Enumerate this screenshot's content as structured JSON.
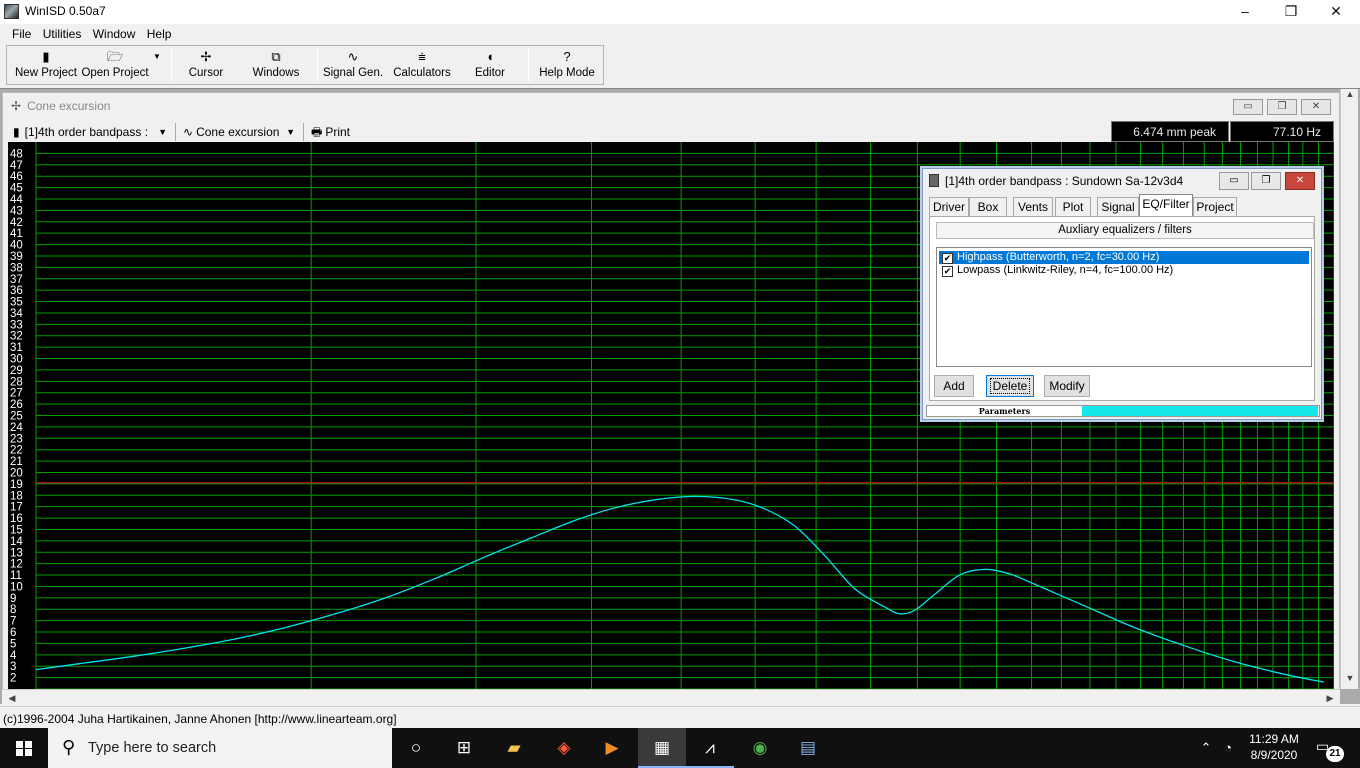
{
  "app": {
    "title": "WinISD 0.50a7",
    "window_controls": {
      "minimize": "–",
      "maximize": "❐",
      "close": "✕"
    }
  },
  "menu": [
    {
      "label": "File"
    },
    {
      "label": "Utilities"
    },
    {
      "label": "Window"
    },
    {
      "label": "Help"
    }
  ],
  "toolbar": {
    "new_project": "New Project",
    "open_project": "Open Project",
    "cursor": "Cursor",
    "windows": "Windows",
    "signal_gen": "Signal Gen.",
    "calculators": "Calculators",
    "editor": "Editor",
    "help_mode": "Help Mode"
  },
  "chart_window": {
    "title": "Cone excursion",
    "project_select": "[1]4th order bandpass :",
    "plot_select": "Cone excursion",
    "print_label": "Print",
    "readout_peak": "6.474 mm peak",
    "readout_freq": "77.10 Hz"
  },
  "chart_data": {
    "type": "line",
    "title": "",
    "xlabel": "",
    "ylabel": "",
    "ylim": [
      1,
      49
    ],
    "y_ticks": [
      2,
      3,
      4,
      5,
      6,
      7,
      8,
      9,
      10,
      11,
      12,
      13,
      14,
      15,
      16,
      17,
      18,
      19,
      20,
      21,
      22,
      23,
      24,
      25,
      26,
      27,
      28,
      29,
      30,
      31,
      32,
      33,
      34,
      35,
      36,
      37,
      38,
      39,
      40,
      41,
      42,
      43,
      44,
      45,
      46,
      47,
      48
    ],
    "grid": true,
    "background": "#000000",
    "grid_color": "#00a000",
    "limit_line": {
      "y": 19.1,
      "color": "#c01020"
    },
    "series": [
      {
        "color": "#00e5ee",
        "points": [
          [
            0,
            2.7
          ],
          [
            50,
            3.3
          ],
          [
            100,
            3.9
          ],
          [
            150,
            4.6
          ],
          [
            200,
            5.4
          ],
          [
            250,
            6.4
          ],
          [
            300,
            7.6
          ],
          [
            350,
            9.0
          ],
          [
            400,
            10.7
          ],
          [
            450,
            12.6
          ],
          [
            500,
            14.4
          ],
          [
            540,
            15.8
          ],
          [
            580,
            16.9
          ],
          [
            620,
            17.6
          ],
          [
            660,
            17.9
          ],
          [
            700,
            17.6
          ],
          [
            730,
            16.8
          ],
          [
            760,
            15.3
          ],
          [
            790,
            12.7
          ],
          [
            820,
            9.8
          ],
          [
            850,
            8.2
          ],
          [
            865,
            7.6
          ],
          [
            880,
            7.9
          ],
          [
            900,
            9.3
          ],
          [
            925,
            11.0
          ],
          [
            950,
            11.5
          ],
          [
            975,
            11.1
          ],
          [
            1000,
            10.2
          ],
          [
            1050,
            8.3
          ],
          [
            1100,
            6.4
          ],
          [
            1150,
            4.8
          ],
          [
            1200,
            3.4
          ],
          [
            1250,
            2.3
          ],
          [
            1290,
            1.6
          ]
        ]
      }
    ]
  },
  "dialog": {
    "title": "[1]4th order bandpass : Sundown Sa-12v3d4",
    "tabs": [
      "Driver",
      "Box",
      "Vents",
      "Plot",
      "Signal",
      "EQ/Filter",
      "Project"
    ],
    "active_tab": "EQ/Filter",
    "section_header": "Auxliary equalizers / filters",
    "filters": [
      {
        "label": "Highpass (Butterworth, n=2, fc=30.00 Hz)",
        "checked": "✔",
        "selected": true
      },
      {
        "label": "Lowpass (Linkwitz-Riley, n=4, fc=100.00 Hz)",
        "checked": "✔",
        "selected": false
      }
    ],
    "add_button": "Add",
    "delete_button": "Delete",
    "modify_button": "Modify",
    "params_label": "Parameters",
    "params_progress": 0.61
  },
  "statusbar": {
    "text": "(c)1996-2004 Juha Hartikainen, Janne Ahonen [http://www.linearteam.org]"
  },
  "taskbar": {
    "search_placeholder": "Type here to search",
    "time": "11:29 AM",
    "date": "8/9/2020",
    "notification_count": "21",
    "icons": [
      "cortana-icon",
      "task-view-icon",
      "file-explorer-icon",
      "fl-studio-icon",
      "video-editor-icon",
      "winisd-icon",
      "audacity-icon",
      "chrome-icon",
      "calculator-icon"
    ]
  }
}
